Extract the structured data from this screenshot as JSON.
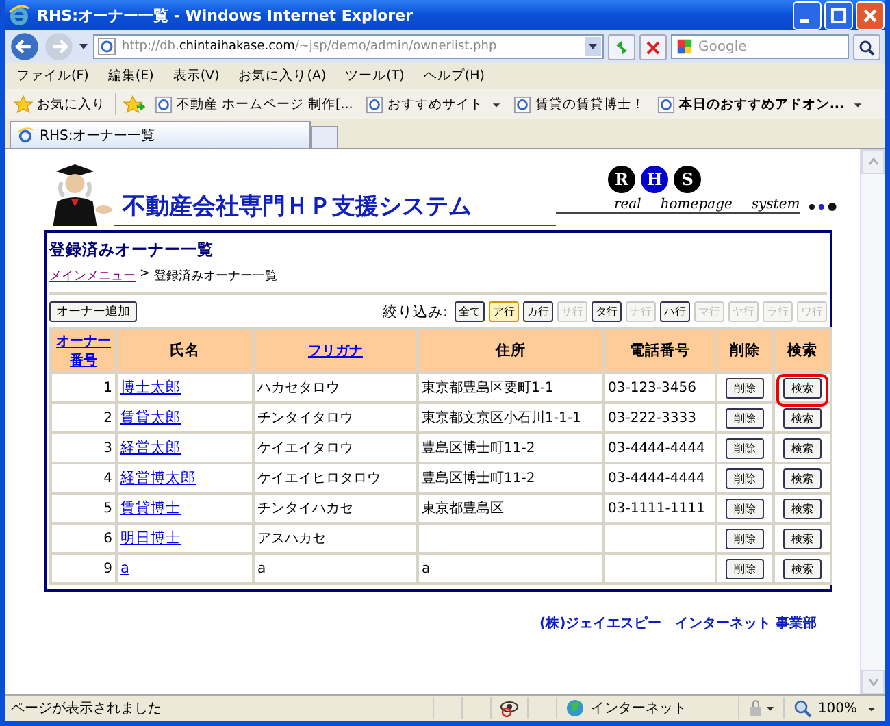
{
  "window": {
    "title": "RHS:オーナー一覧 - Windows Internet Explorer"
  },
  "address_bar": {
    "url_host_prefix": "http://db.",
    "url_host": "chintaihakase.com",
    "url_path": "/~jsp/demo/admin/ownerlist.php",
    "search_placeholder": "Google"
  },
  "menu": [
    "ファイル(F)",
    "編集(E)",
    "表示(V)",
    "お気に入り(A)",
    "ツール(T)",
    "ヘルプ(H)"
  ],
  "favorites_bar": {
    "label": "お気に入り",
    "links": [
      {
        "label": "不動産 ホームページ 制作[...",
        "bold": false,
        "dropdown": false
      },
      {
        "label": "おすすめサイト",
        "bold": false,
        "dropdown": true
      },
      {
        "label": "賃貸の賃貸博士！",
        "bold": false,
        "dropdown": false
      },
      {
        "label": "本日のおすすめアドオン...",
        "bold": true,
        "dropdown": true
      }
    ]
  },
  "tabs": [
    {
      "label": "RHS:オーナー一覧",
      "selected": true
    }
  ],
  "page": {
    "site_title": "不動産会社専門ＨＰ支援システム",
    "badges": [
      {
        "letter": "R",
        "color": "#000000"
      },
      {
        "letter": "H",
        "color": "#0000cc"
      },
      {
        "letter": "S",
        "color": "#000000"
      }
    ],
    "tagline": [
      "real",
      "homepage",
      "system"
    ],
    "heading": "登録済みオーナー一覧",
    "breadcrumb": {
      "link": "メインメニュー",
      "separator": ">",
      "current": "登録済みオーナー一覧"
    },
    "add_button": "オーナー追加",
    "filter_label": "絞り込み:",
    "filters": [
      {
        "label": "全て",
        "selected": false,
        "disabled": false
      },
      {
        "label": "ア行",
        "selected": true,
        "disabled": false
      },
      {
        "label": "カ行",
        "selected": false,
        "disabled": false
      },
      {
        "label": "サ行",
        "selected": false,
        "disabled": true
      },
      {
        "label": "タ行",
        "selected": false,
        "disabled": false
      },
      {
        "label": "ナ行",
        "selected": false,
        "disabled": true
      },
      {
        "label": "ハ行",
        "selected": false,
        "disabled": false
      },
      {
        "label": "マ行",
        "selected": false,
        "disabled": true
      },
      {
        "label": "ヤ行",
        "selected": false,
        "disabled": true
      },
      {
        "label": "ラ行",
        "selected": false,
        "disabled": true
      },
      {
        "label": "ワ行",
        "selected": false,
        "disabled": true
      }
    ],
    "table": {
      "columns": [
        {
          "label": "オーナー番号",
          "link": true
        },
        {
          "label": "氏名",
          "link": false
        },
        {
          "label": "フリガナ",
          "link": true
        },
        {
          "label": "住所",
          "link": false
        },
        {
          "label": "電話番号",
          "link": false
        },
        {
          "label": "削除",
          "link": false
        },
        {
          "label": "検索",
          "link": false
        }
      ],
      "rows": [
        {
          "number": "1",
          "name": "博士太郎",
          "kana": "ハカセタロウ",
          "address": "東京都豊島区要町1-1",
          "phone": "03-123-3456",
          "delete": "削除",
          "search": "検索",
          "highlighted": true
        },
        {
          "number": "2",
          "name": "賃貸太郎",
          "kana": "チンタイタロウ",
          "address": "東京都文京区小石川1-1-1",
          "phone": "03-222-3333",
          "delete": "削除",
          "search": "検索",
          "highlighted": false
        },
        {
          "number": "3",
          "name": "経営太郎",
          "kana": "ケイエイタロウ",
          "address": "豊島区博士町11-2",
          "phone": "03-4444-4444",
          "delete": "削除",
          "search": "検索",
          "highlighted": false
        },
        {
          "number": "4",
          "name": "経営博太郎",
          "kana": "ケイエイヒロタロウ",
          "address": "豊島区博士町11-2",
          "phone": "03-4444-4444",
          "delete": "削除",
          "search": "検索",
          "highlighted": false
        },
        {
          "number": "5",
          "name": "賃貸博士",
          "kana": "チンタイハカセ",
          "address": "東京都豊島区",
          "phone": "03-1111-1111",
          "delete": "削除",
          "search": "検索",
          "highlighted": false
        },
        {
          "number": "6",
          "name": "明日博士",
          "kana": "アスハカセ",
          "address": "",
          "phone": "",
          "delete": "削除",
          "search": "検索",
          "highlighted": false
        },
        {
          "number": "9",
          "name": "a",
          "kana": "a",
          "address": "a",
          "phone": "",
          "delete": "削除",
          "search": "検索",
          "highlighted": false
        }
      ]
    },
    "footer": "(株)ジェイエスピー　インターネット 事業部"
  },
  "status_bar": {
    "text": "ページが表示されました",
    "zone": "インターネット",
    "zoom": "100%"
  }
}
